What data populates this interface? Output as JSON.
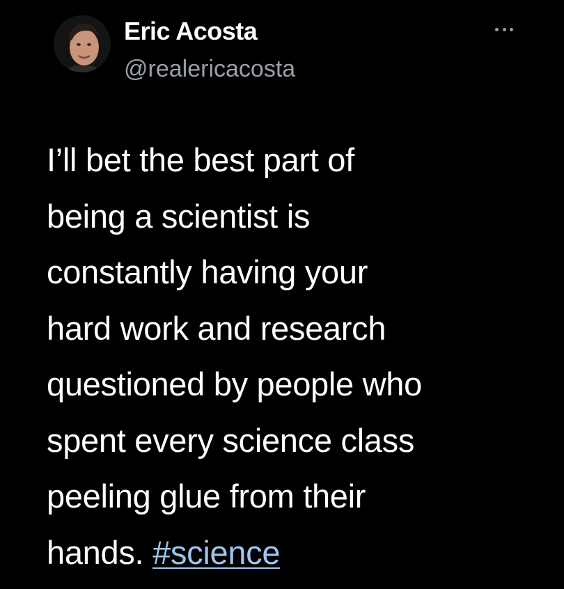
{
  "author": {
    "name": "Eric Acosta",
    "handle": "@realericacosta",
    "avatar_icon": "profile-photo"
  },
  "more_icon": "more-options-icon",
  "tweet": {
    "lines": [
      "I’ll bet the best part of",
      "being a scientist is",
      "constantly having your",
      "hard work and research",
      "questioned by people who",
      "spent every science class",
      "peeling glue from their"
    ],
    "last_line_text": "hands.",
    "hashtag": "#science"
  },
  "colors": {
    "background": "#000000",
    "text": "#ffffff",
    "handle": "#9aa0a6",
    "hashtag": "#9fc6ee"
  }
}
